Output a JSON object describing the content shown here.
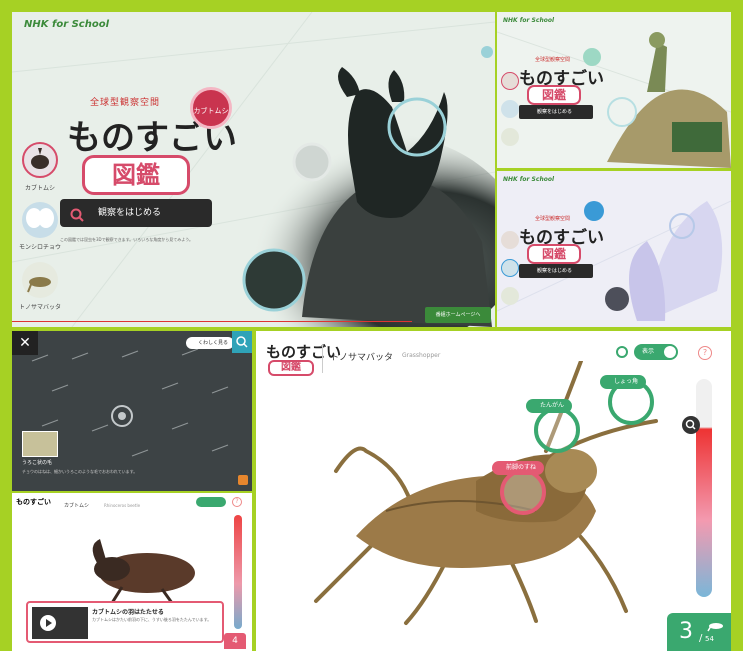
{
  "colors": {
    "frame": "#a6d124",
    "brand_green": "#3aa86f",
    "brand_pink": "#d64b6a",
    "nhk_green": "#3b8a3a"
  },
  "landing": {
    "brand": "NHK for School",
    "subtitle": "全球型観察空間",
    "title": "ものすごい",
    "zukan": "図鑑",
    "badge": "カブトムシ",
    "search_label": "観察をはじめる",
    "description": "この図鑑では昆虫を3Dで観察できます。いろいろな角度から見てみよう。",
    "cta": "番組ホームページへ",
    "thumbs": [
      {
        "label": "カブトムシ",
        "icon": "beetle-icon"
      },
      {
        "label": "モンシロチョウ",
        "icon": "butterfly-icon"
      },
      {
        "label": "トノサマバッタ",
        "icon": "grasshopper-icon"
      }
    ]
  },
  "mini_b": {
    "brand": "NHK for School",
    "subtitle": "全球型観察空間",
    "title": "ものすごい",
    "zukan": "図鑑",
    "search_label": "観察をはじめる"
  },
  "mini_c": {
    "brand": "NHK for School",
    "subtitle": "全球型観察空間",
    "title": "ものすごい",
    "zukan": "図鑑",
    "search_label": "観察をはじめる"
  },
  "microscope": {
    "close": "✕",
    "toggle_label": "くわしく見る",
    "caption": "うろこ状の毛",
    "caption_body": "チョウのはねは、細かいうろこのような毛でおおわれています。"
  },
  "beetle_detail": {
    "logo_title": "ものすごい",
    "insect_name": "カブトムシ",
    "insect_en": "Rhinoceros beetle",
    "help": "?",
    "popup_title": "カブトムシの羽はたたせる",
    "popup_text": "カブトムシはかたい前羽の下に、うすい後ろ羽をたたんでいます。",
    "counter": "4"
  },
  "grasshopper_detail": {
    "logo_title": "ものすごい",
    "logo_zukan": "図鑑",
    "insect_name": "トノサマバッタ",
    "insect_en": "Grasshopper",
    "toggle_label": "表示",
    "help": "?",
    "hotspots": [
      {
        "label": "しょっ角",
        "color": "#3aa86f"
      },
      {
        "label": "たんがん",
        "color": "#3aa86f"
      },
      {
        "label": "前脚のすね",
        "color": "#e45a73"
      }
    ],
    "counter_current": "3",
    "counter_sep": "/",
    "counter_total": "54"
  }
}
